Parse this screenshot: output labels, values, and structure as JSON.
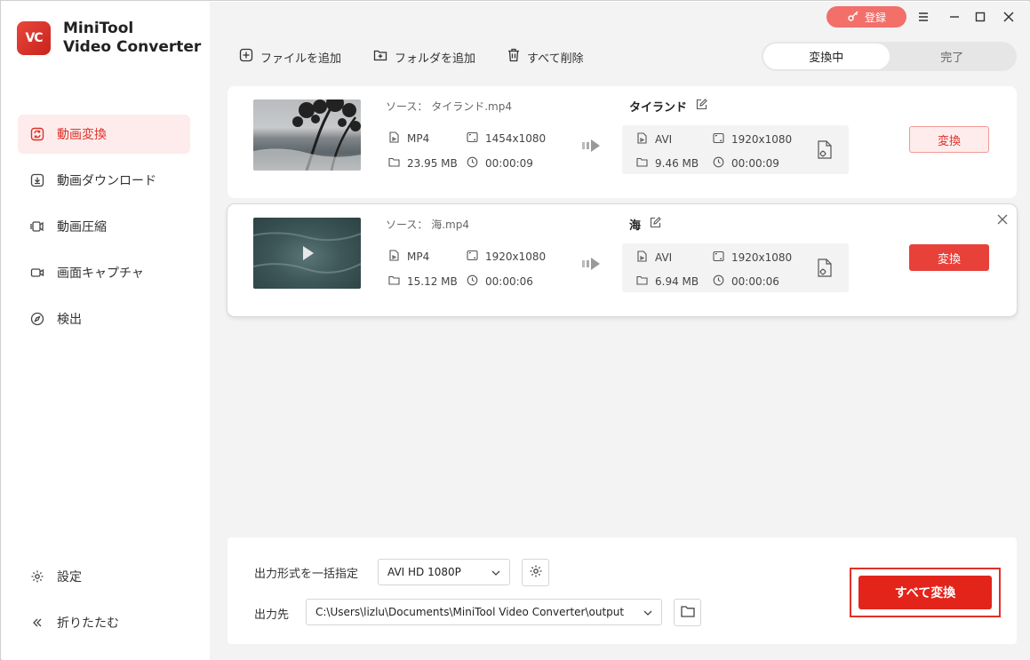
{
  "app": {
    "logo_abbr": "VC",
    "name_line1": "MiniTool",
    "name_line2": "Video Converter"
  },
  "titlebar": {
    "register_label": "登録"
  },
  "sidebar": {
    "items": [
      {
        "label": "動画変換",
        "icon": "convert-icon"
      },
      {
        "label": "動画ダウンロード",
        "icon": "download-icon"
      },
      {
        "label": "動画圧縮",
        "icon": "compress-icon"
      },
      {
        "label": "画面キャプチャ",
        "icon": "camera-icon"
      },
      {
        "label": "検出",
        "icon": "compass-icon"
      }
    ],
    "bottom": [
      {
        "label": "設定",
        "icon": "gear-icon"
      },
      {
        "label": "折りたたむ",
        "icon": "collapse-icon"
      }
    ]
  },
  "toolbar": {
    "add_file": "ファイルを追加",
    "add_folder": "フォルダを追加",
    "delete_all": "すべて削除"
  },
  "tabs": {
    "converting": "変換中",
    "done": "完了"
  },
  "files": [
    {
      "source": "ソース：  タイランド.mp4",
      "src_format": "MP4",
      "src_resolution": "1454x1080",
      "src_size": "23.95 MB",
      "src_duration": "00:00:09",
      "out_name": "タイランド",
      "out_format": "AVI",
      "out_resolution": "1920x1080",
      "out_size": "9.46 MB",
      "out_duration": "00:00:09",
      "convert_label": "変換"
    },
    {
      "source": "ソース：  海.mp4",
      "src_format": "MP4",
      "src_resolution": "1920x1080",
      "src_size": "15.12 MB",
      "src_duration": "00:00:06",
      "out_name": "海",
      "out_format": "AVI",
      "out_resolution": "1920x1080",
      "out_size": "6.94 MB",
      "out_duration": "00:00:06",
      "convert_label": "変換"
    }
  ],
  "bottom": {
    "format_label": "出力形式を一括指定",
    "format_value": "AVI HD 1080P",
    "output_label": "出力先",
    "output_path": "C:\\Users\\lizlu\\Documents\\MiniTool Video Converter\\output",
    "convert_all": "すべて変換"
  },
  "colors": {
    "accent": "#e3241b",
    "accent_light": "#fdeceb"
  }
}
